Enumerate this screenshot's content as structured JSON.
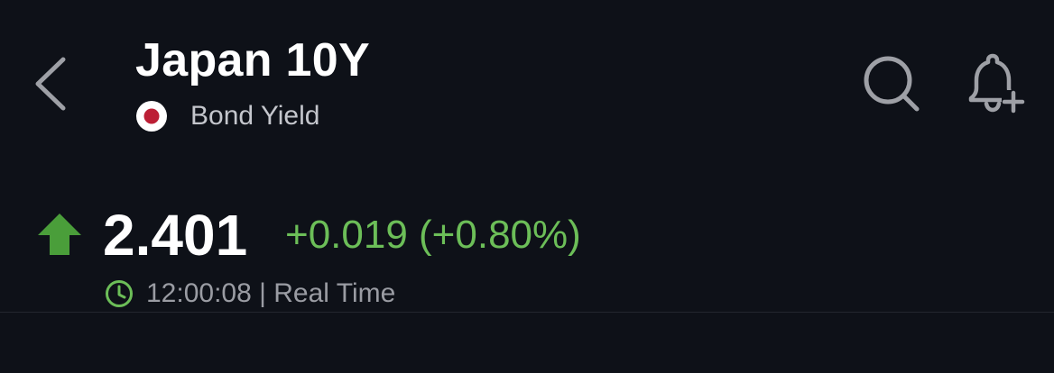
{
  "header": {
    "title": "Japan 10Y",
    "subtitle": "Bond Yield",
    "flag": "japan-flag-icon",
    "actions": [
      "back-icon",
      "search-icon",
      "bell-plus-icon"
    ]
  },
  "quote": {
    "price": "2.401",
    "change": "+0.019 (+0.80%)",
    "direction": "up",
    "timestamp": "12:00:08 | Real Time"
  },
  "colors": {
    "background": "#0e1118",
    "positive": "#6cbe58",
    "up_arrow": "#4a9e3a",
    "text_primary": "#ffffff",
    "text_secondary": "#c4c6cc",
    "text_muted": "#9a9ca3",
    "icon_gray": "#9ea0a6",
    "flag_red": "#bc1f35"
  }
}
